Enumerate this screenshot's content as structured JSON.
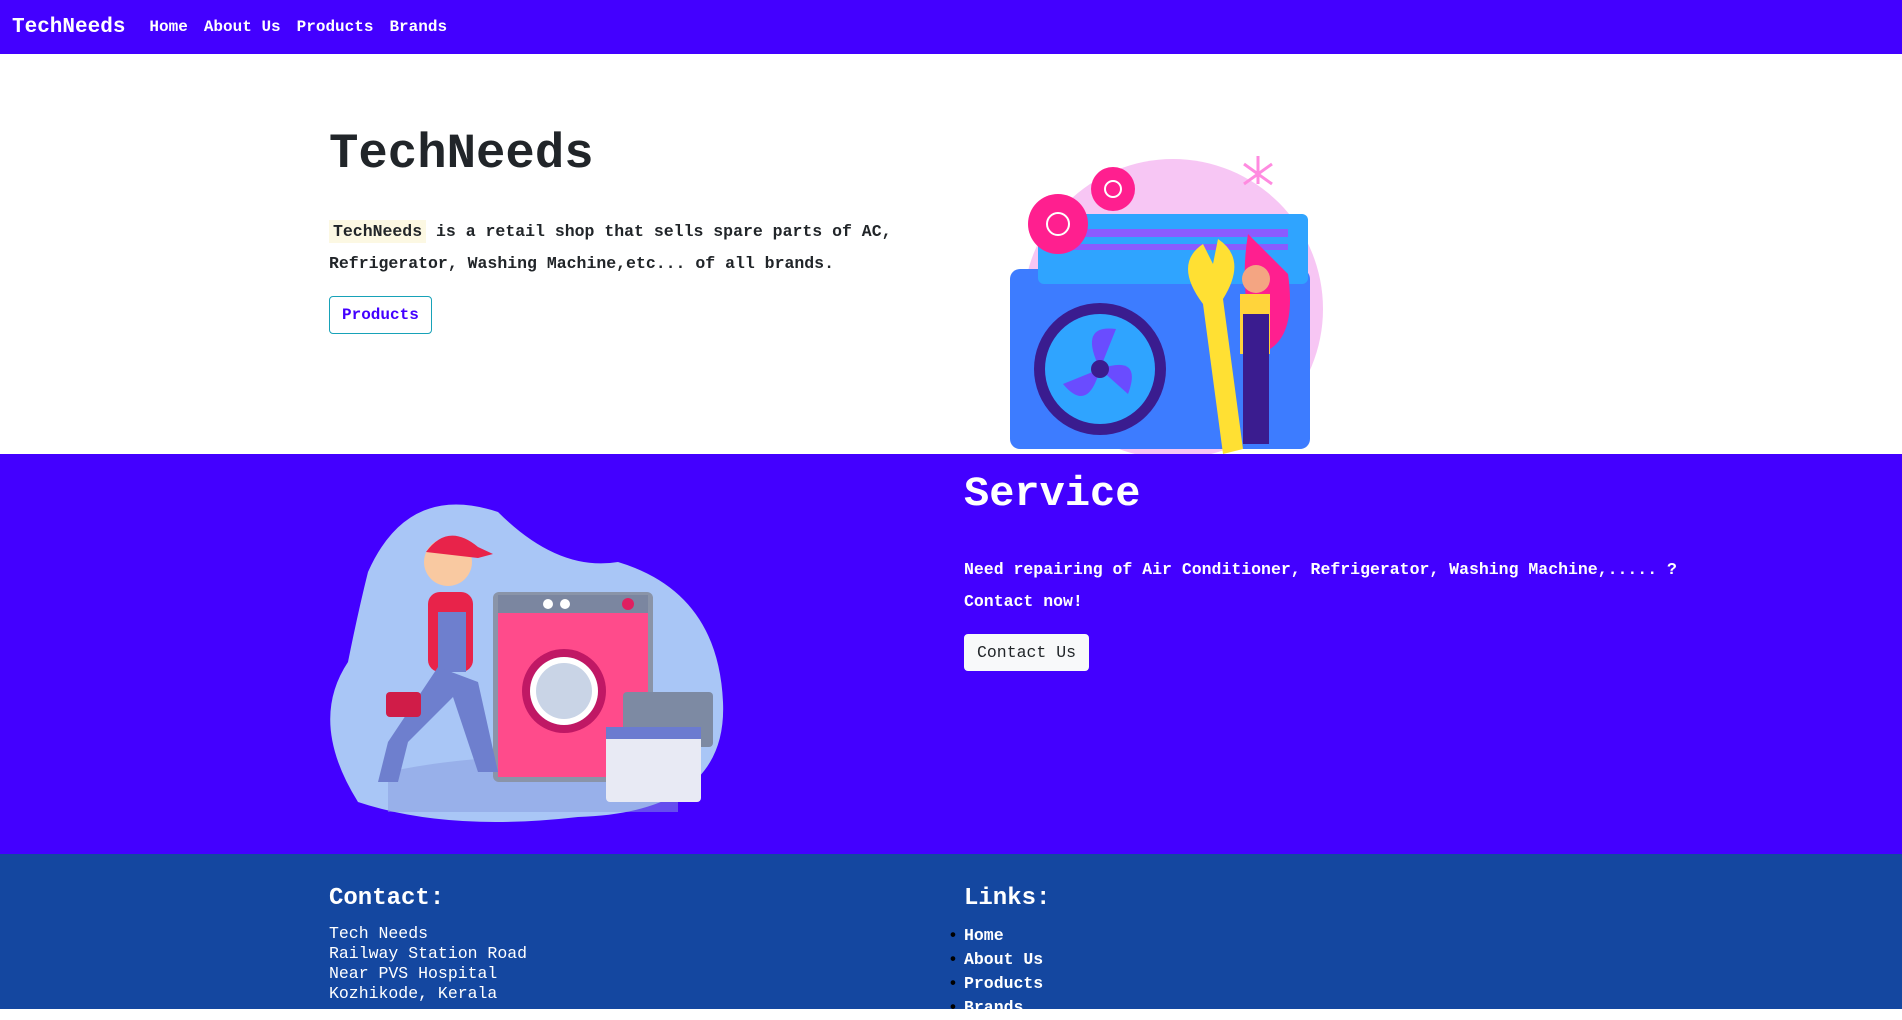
{
  "nav": {
    "brand": "TechNeeds",
    "links": [
      "Home",
      "About Us",
      "Products",
      "Brands"
    ]
  },
  "hero": {
    "title": "TechNeeds",
    "highlight": "TechNeeds",
    "text_line1": " is a retail shop that sells spare parts of AC,",
    "text_line2": "Refrigerator, Washing Machine,etc... of all brands.",
    "button": "Products",
    "image": "ac-repair-illustration"
  },
  "service": {
    "title": "Service",
    "text_line1": "Need repairing of Air Conditioner, Refrigerator, Washing Machine,..... ?",
    "text_line2": "Contact now!",
    "button": "Contact Us",
    "image": "washing-machine-repair-illustration"
  },
  "footer": {
    "contact_heading": "Contact:",
    "address": [
      "Tech Needs",
      "Railway Station Road",
      "Near PVS Hospital",
      "Kozhikode, Kerala"
    ],
    "links_heading": "Links:",
    "links": [
      "Home",
      "About Us",
      "Products",
      "Brands"
    ]
  },
  "colors": {
    "primary": "#4300ff",
    "footer": "#1447a0",
    "highlight": "#fcf8e3",
    "outline": "#17a2b8"
  }
}
